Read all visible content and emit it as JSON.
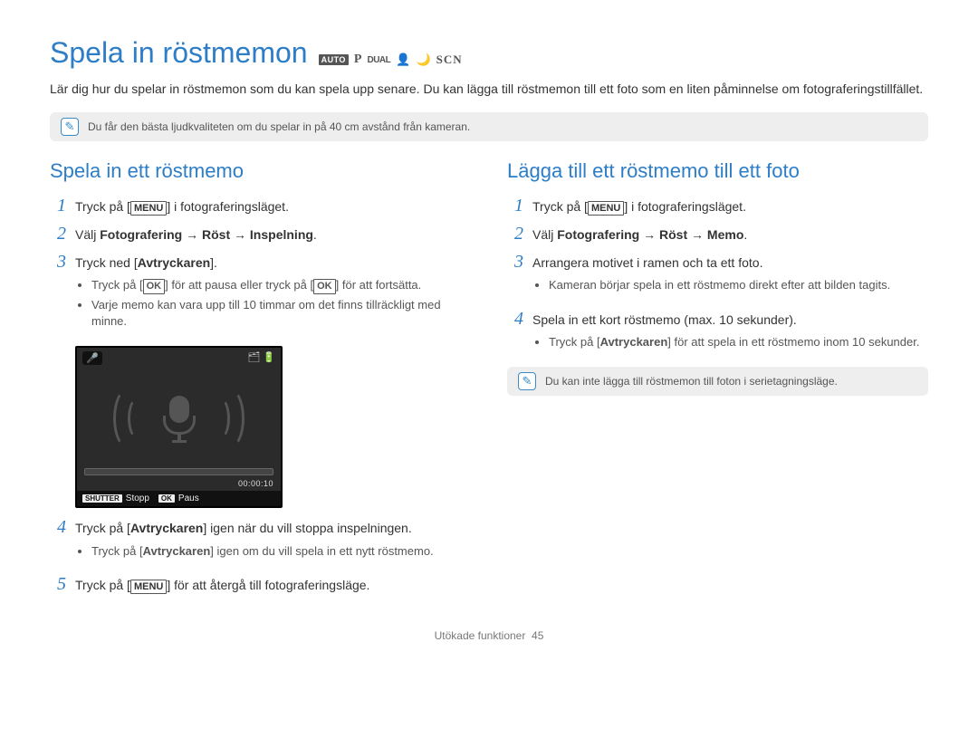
{
  "header": {
    "title": "Spela in röstmemon",
    "modes": {
      "auto": "AUTO",
      "p": "P",
      "dual": "DUAL",
      "scn": "SCN"
    }
  },
  "intro": "Lär dig hur du spelar in röstmemon som du kan spela upp senare. Du kan lägga till röstmemon till ett foto som en liten påminnelse om fotograferingstillfället.",
  "note_top": "Du får den bästa ljudkvaliteten om du spelar in på 40 cm avstånd från kameran.",
  "left": {
    "heading": "Spela in ett röstmemo",
    "s1_a": "Tryck på [",
    "s1_menu": "MENU",
    "s1_b": "] i fotograferingsläget.",
    "s2_a": "Välj ",
    "s2_b": "Fotografering",
    "s2_arrow1": " → ",
    "s2_c": "Röst",
    "s2_arrow2": " → ",
    "s2_d": "Inspelning",
    "s2_e": ".",
    "s3_a": "Tryck ned [",
    "s3_b": "Avtryckaren",
    "s3_c": "].",
    "s3_sub1_a": "Tryck på [",
    "s3_sub1_ok1": "OK",
    "s3_sub1_b": "] för att pausa eller tryck på [",
    "s3_sub1_ok2": "OK",
    "s3_sub1_c": "] för att fortsätta.",
    "s3_sub2": "Varje memo kan vara upp till 10 timmar om det finns tillräckligt med minne.",
    "shot_time": "00:00:10",
    "shot_shutter": "SHUTTER",
    "shot_stop": "Stopp",
    "shot_ok": "OK",
    "shot_paus": "Paus",
    "s4_a": "Tryck på [",
    "s4_b": "Avtryckaren",
    "s4_c": "] igen när du vill stoppa inspelningen.",
    "s4_sub_a": "Tryck på [",
    "s4_sub_b": "Avtryckaren",
    "s4_sub_c": "] igen om du vill spela in ett nytt röstmemo.",
    "s5_a": "Tryck på [",
    "s5_menu": "MENU",
    "s5_b": "] för att återgå till fotograferingsläge."
  },
  "right": {
    "heading": "Lägga till ett röstmemo till ett foto",
    "s1_a": "Tryck på [",
    "s1_menu": "MENU",
    "s1_b": "] i fotograferingsläget.",
    "s2_a": "Välj ",
    "s2_b": "Fotografering",
    "s2_arrow1": " → ",
    "s2_c": "Röst",
    "s2_arrow2": " → ",
    "s2_d": "Memo",
    "s2_e": ".",
    "s3": "Arrangera motivet i ramen och ta ett foto.",
    "s3_sub": "Kameran börjar spela in ett röstmemo direkt efter att bilden tagits.",
    "s4": "Spela in ett kort röstmemo (max. 10 sekunder).",
    "s4_sub_a": "Tryck på [",
    "s4_sub_b": "Avtryckaren",
    "s4_sub_c": "] för att spela in ett röstmemo inom 10 sekunder.",
    "note": "Du kan inte lägga till röstmemon till foton i serietagningsläge."
  },
  "footer": {
    "section": "Utökade funktioner",
    "page": "45"
  }
}
